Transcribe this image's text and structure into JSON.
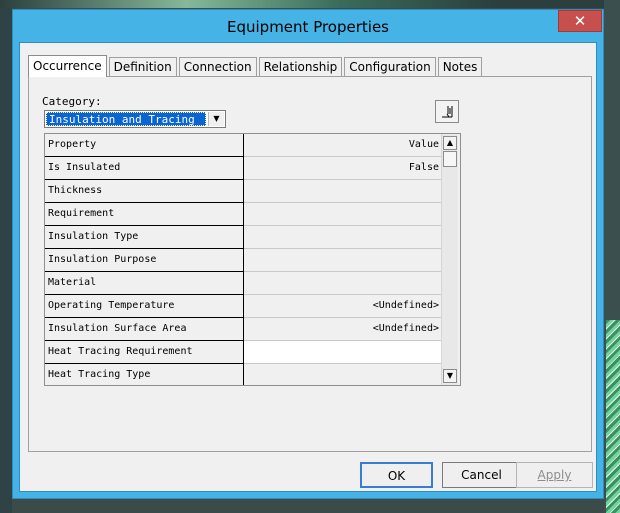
{
  "window": {
    "title": "Equipment Properties",
    "close_glyph": "✕"
  },
  "tabs": [
    {
      "label": "Occurrence",
      "active": true
    },
    {
      "label": "Definition"
    },
    {
      "label": "Connection"
    },
    {
      "label": "Relationship"
    },
    {
      "label": "Configuration"
    },
    {
      "label": "Notes"
    }
  ],
  "category": {
    "label": "Category:",
    "selected": "Insulation and Tracing",
    "arrow": "▼"
  },
  "toolbar": {
    "icon": "properties-tool-icon"
  },
  "grid": {
    "header": {
      "name": "Property",
      "value": "Value"
    },
    "rows": [
      {
        "name": "Is Insulated",
        "value": "False"
      },
      {
        "name": "Thickness",
        "value": ""
      },
      {
        "name": "Requirement",
        "value": ""
      },
      {
        "name": "Insulation Type",
        "value": ""
      },
      {
        "name": "Insulation Purpose",
        "value": ""
      },
      {
        "name": "Material",
        "value": ""
      },
      {
        "name": "Operating Temperature",
        "value": "<Undefined>"
      },
      {
        "name": "Insulation Surface Area",
        "value": "<Undefined>"
      },
      {
        "name": "Heat Tracing Requirement",
        "value": ""
      },
      {
        "name": "Heat Tracing Type",
        "value": ""
      }
    ],
    "scroll_up": "▲",
    "scroll_down": "▼"
  },
  "buttons": {
    "ok": "OK",
    "cancel": "Cancel",
    "apply": "Apply"
  },
  "colors": {
    "title_bar": "#45b3e6",
    "close": "#c7504f",
    "selection": "#0a64d2"
  }
}
